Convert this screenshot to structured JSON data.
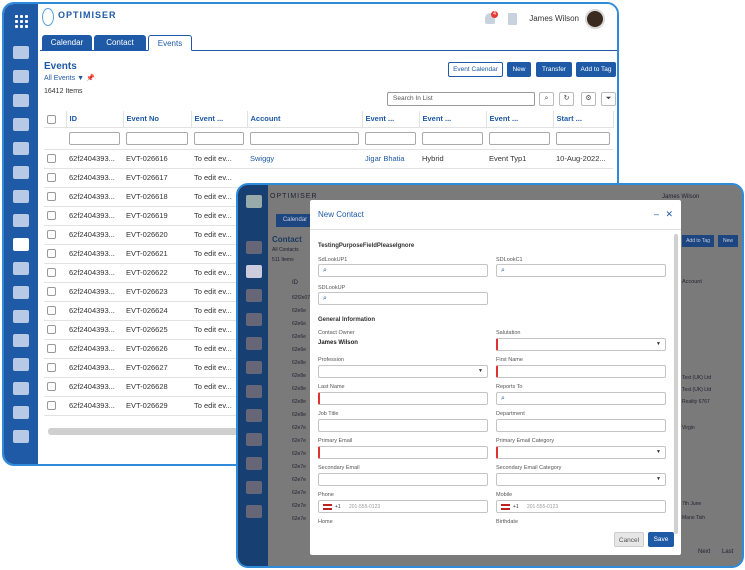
{
  "app": {
    "logo": "OPTIMISER",
    "user_name": "James Wilson",
    "notification_count": "4"
  },
  "tabs": [
    {
      "label": "Calendar"
    },
    {
      "label": "Contact"
    },
    {
      "label": "Events"
    }
  ],
  "events_page": {
    "title": "Events",
    "view": "All Events",
    "count": "16412 Items",
    "buttons": {
      "event_calendar": "Event Calendar",
      "new": "New",
      "transfer": "Transfer",
      "add_to_tag": "Add to Tag"
    },
    "search_placeholder": "Search In List",
    "columns": [
      "ID",
      "Event No",
      "Event ...",
      "Account",
      "Event ...",
      "Event ...",
      "Event ...",
      "Start ..."
    ],
    "rows": [
      {
        "id": "62f2404393...",
        "event_no": "EVT-026616",
        "name": "To edit ev...",
        "account": "Swiggy",
        "person": "Jigar Bhatia",
        "type": "Hybrid",
        "event_type": "Event Typ1",
        "start": "10-Aug-2022..."
      },
      {
        "id": "62f2404393...",
        "event_no": "EVT-026617",
        "name": "To edit ev..."
      },
      {
        "id": "62f2404393...",
        "event_no": "EVT-026618",
        "name": "To edit ev..."
      },
      {
        "id": "62f2404393...",
        "event_no": "EVT-026619",
        "name": "To edit ev..."
      },
      {
        "id": "62f2404393...",
        "event_no": "EVT-026620",
        "name": "To edit ev..."
      },
      {
        "id": "62f2404393...",
        "event_no": "EVT-026621",
        "name": "To edit ev..."
      },
      {
        "id": "62f2404393...",
        "event_no": "EVT-026622",
        "name": "To edit ev..."
      },
      {
        "id": "62f2404393...",
        "event_no": "EVT-026623",
        "name": "To edit ev..."
      },
      {
        "id": "62f2404393...",
        "event_no": "EVT-026624",
        "name": "To edit ev..."
      },
      {
        "id": "62f2404393...",
        "event_no": "EVT-026625",
        "name": "To edit ev..."
      },
      {
        "id": "62f2404393...",
        "event_no": "EVT-026626",
        "name": "To edit ev..."
      },
      {
        "id": "62f2404393...",
        "event_no": "EVT-026627",
        "name": "To edit ev..."
      },
      {
        "id": "62f2404393...",
        "event_no": "EVT-026628",
        "name": "To edit ev..."
      },
      {
        "id": "62f2404393...",
        "event_no": "EVT-026629",
        "name": "To edit ev..."
      }
    ]
  },
  "contact_bg": {
    "title": "Contact",
    "view": "All Contacts",
    "count": "511 Items",
    "col_id": "ID",
    "col_account": "Account",
    "add_to_tag": "Add to Tag",
    "new": "New",
    "ids": [
      "62f2e07",
      "62e6e",
      "62e6e",
      "62e6e",
      "62e6e",
      "62e8e",
      "62e8e",
      "62e8e",
      "62e8e",
      "62e8e",
      "62e7e",
      "62e7e",
      "62e7e",
      "62e7e",
      "62e7e",
      "62e7e",
      "62e7e",
      "62e7e"
    ],
    "right_texts": [
      "Test (UK) Ltd",
      "Test (UK) Ltd",
      "Reality 6767",
      "Virgin",
      "7th June",
      "Mano Tish"
    ],
    "pager": [
      "Next",
      "Last"
    ]
  },
  "modal": {
    "title": "New Contact",
    "section_custom": "TestingPurposeFieldPleaseIgnore",
    "labels": {
      "sdlookup1": "SdLookUP1",
      "sdlookc1": "SDLookC1",
      "sdlookup": "SDLookUP",
      "owner": "Contact Owner",
      "salutation": "Salutation",
      "profession": "Profession",
      "first_name": "First Name",
      "last_name": "Last Name",
      "reports_to": "Reports To",
      "job_title": "Job Title",
      "department": "Department",
      "primary_email": "Primary Email",
      "primary_email_cat": "Primary Email Category",
      "secondary_email": "Secondary Email",
      "secondary_email_cat": "Secondary Email Category",
      "phone": "Phone",
      "mobile": "Mobile",
      "home": "Home",
      "birthdate": "Birthdate"
    },
    "section_general": "General Information",
    "owner_value": "James Wilson",
    "phone_code": "+1",
    "phone_placeholder": "201-555-0123",
    "cancel": "Cancel",
    "save": "Save"
  }
}
